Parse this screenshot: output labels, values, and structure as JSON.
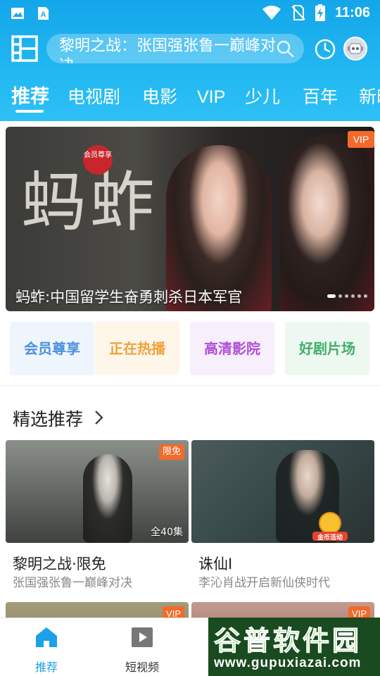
{
  "status_bar": {
    "time": "11:06"
  },
  "search": {
    "text": "黎明之战：张国强张鲁一巅峰对决"
  },
  "tabs": [
    {
      "label": "推荐",
      "active": true
    },
    {
      "label": "电视剧"
    },
    {
      "label": "电影"
    },
    {
      "label": "VIP"
    },
    {
      "label": "少儿"
    },
    {
      "label": "百年"
    },
    {
      "label": "新时"
    }
  ],
  "banner": {
    "title": "蚂蚱:中国留学生奋勇刺杀日本军官",
    "badge": "VIP",
    "calligraphy": "蚂蚱",
    "seal_text": "会员尊享",
    "dots_total": 6,
    "active_dot": 0
  },
  "quick_entries": [
    {
      "label": "会员尊享",
      "color": "#4a90e2",
      "bg": "#eef5fd"
    },
    {
      "label": "正在热播",
      "color": "#f0a13a",
      "bg": "#fdf6e9"
    },
    {
      "label": "高清影院",
      "color": "#b04ed8",
      "bg": "#f8effd"
    },
    {
      "label": "好剧片场",
      "color": "#3fae6a",
      "bg": "#edf8f1"
    }
  ],
  "section": {
    "title": "精选推荐"
  },
  "cards": [
    {
      "title": "黎明之战·限免",
      "subtitle": "张国强张鲁一巅峰对决",
      "badge": "限免",
      "episodes": "全40集"
    },
    {
      "title": "诛仙I",
      "subtitle": "李沁肖战开启新仙侠时代",
      "coin_label": "金币活动"
    },
    {
      "badge": "VIP"
    },
    {
      "badge": "VIP"
    }
  ],
  "bottom_nav": [
    {
      "label": "推荐",
      "active": true
    },
    {
      "label": "短视频"
    }
  ],
  "watermark": {
    "big": "谷普软件园",
    "small": "www.gupuxiazai.com"
  },
  "colors": {
    "accent": "#1aa1e8",
    "header_top": "#14a6ea",
    "header_bottom": "#2fc0f5",
    "vip_orange": "#f26a2c"
  }
}
